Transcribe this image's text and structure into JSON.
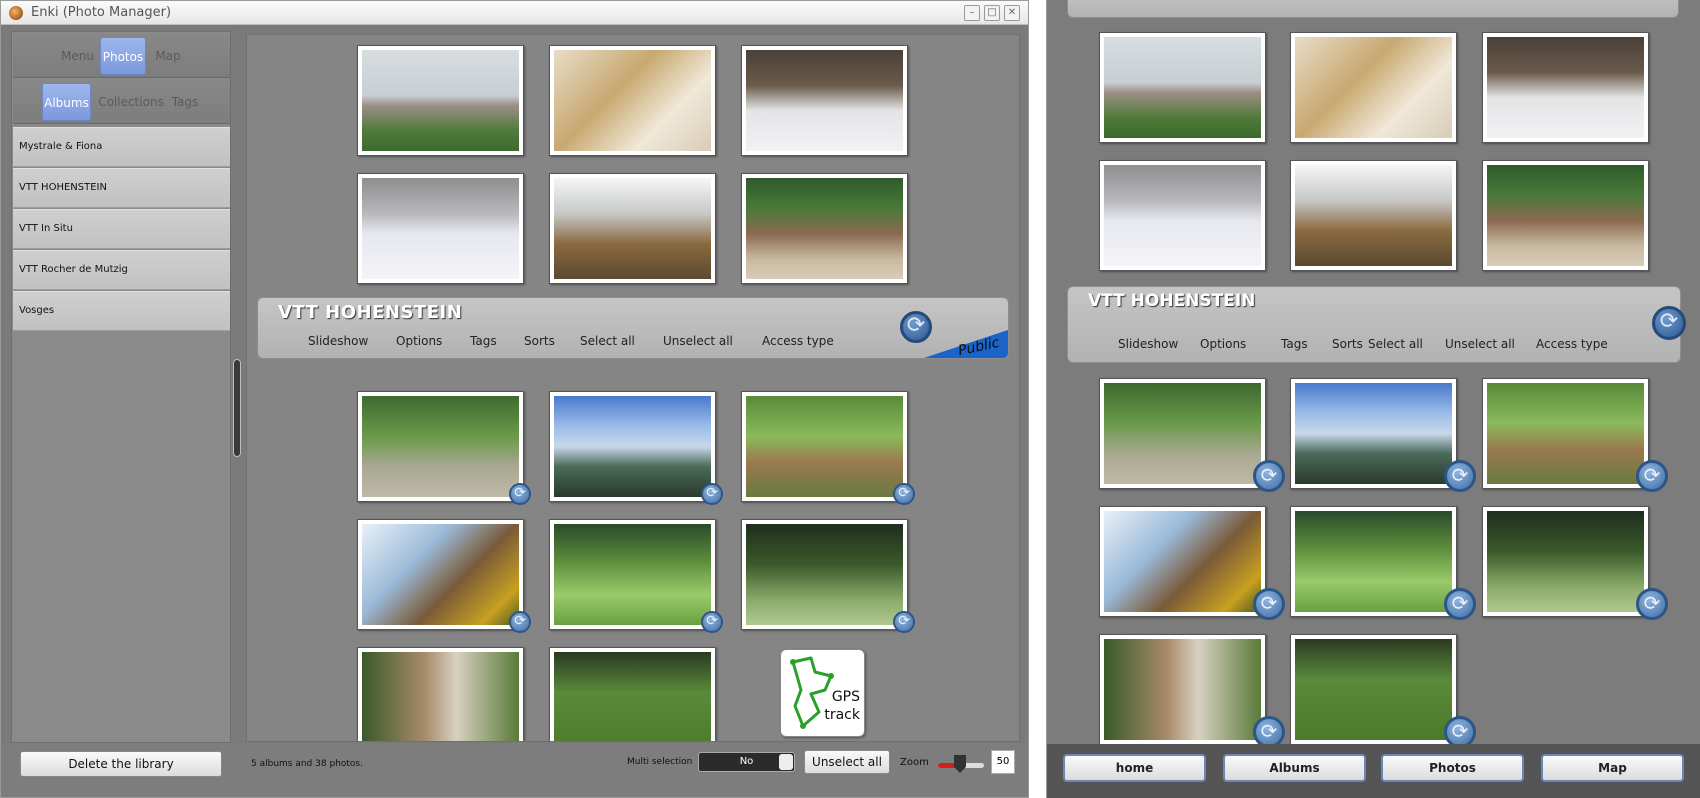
{
  "window": {
    "title": "Enki (Photo Manager)"
  },
  "sidebar": {
    "nav_tabs": [
      "Menu",
      "Photos",
      "Map"
    ],
    "sub_tabs": [
      "Albums",
      "Collections",
      "Tags"
    ],
    "albums": [
      "Mystrale & Fiona",
      "VTT HOHENSTEIN",
      "VTT In Situ",
      "VTT Rocher de Mutzig",
      "Vosges"
    ],
    "delete_label": "Delete the library"
  },
  "album_header": {
    "title": "VTT HOHENSTEIN",
    "menu": [
      "Slideshow",
      "Options",
      "Tags",
      "Sorts",
      "Select all",
      "Unselect all",
      "Access type"
    ],
    "access_badge": "Public"
  },
  "gps": {
    "line1": "GPS",
    "line2": "track"
  },
  "bottom": {
    "status": "5 albums and 38 photos.",
    "multi_label": "Multi selection",
    "multi_value": "No",
    "unselect_label": "Unselect all",
    "zoom_label": "Zoom",
    "zoom_value": "50"
  },
  "right_window": {
    "header_title": "VTT HOHENSTEIN",
    "menu": [
      "Slideshow",
      "Options",
      "Tags",
      "Sorts",
      "Select all",
      "Unselect all",
      "Access type"
    ],
    "bottom_buttons": [
      "home",
      "Albums",
      "Photos",
      "Map"
    ]
  },
  "colors": {
    "accent": "#7c99dc",
    "public_badge": "#1a63c9",
    "sync_icon": "#3f6fa6",
    "zoom_fill": "#d02020"
  }
}
